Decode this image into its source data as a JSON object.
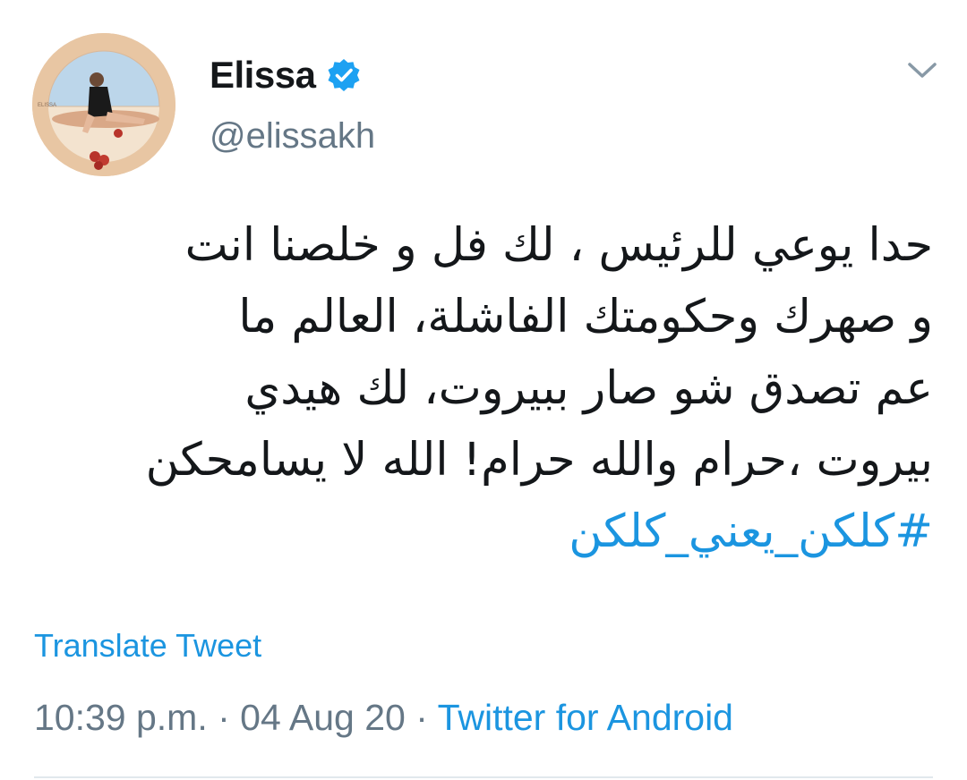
{
  "author": {
    "display_name": "Elissa",
    "handle": "@elissakh",
    "verified": true,
    "verified_icon": "verified-badge-icon",
    "avatar_brand_text": "ELISSA"
  },
  "menu": {
    "icon": "chevron-down-icon"
  },
  "tweet": {
    "lines": [
      "حدا يوعي للرئيس ،  لك فل و خلصنا انت",
      "و صهرك وحكومتك الفاشلة،  العالم  ما",
      "عم تصدق شو صار ببيروت، لك هيدي",
      "بيروت ،حرام والله حرام! الله لا يسامحكن"
    ],
    "hashtag": "#كلكن_يعني_كلكن"
  },
  "translate_label": "Translate Tweet",
  "meta": {
    "time": "10:39 p.m.",
    "separator": " · ",
    "date": "04 Aug 20",
    "source": "Twitter for Android"
  },
  "colors": {
    "link": "#1b95e0",
    "secondary_text": "#657786",
    "primary_text": "#14171a",
    "verified": "#1da1f2"
  }
}
